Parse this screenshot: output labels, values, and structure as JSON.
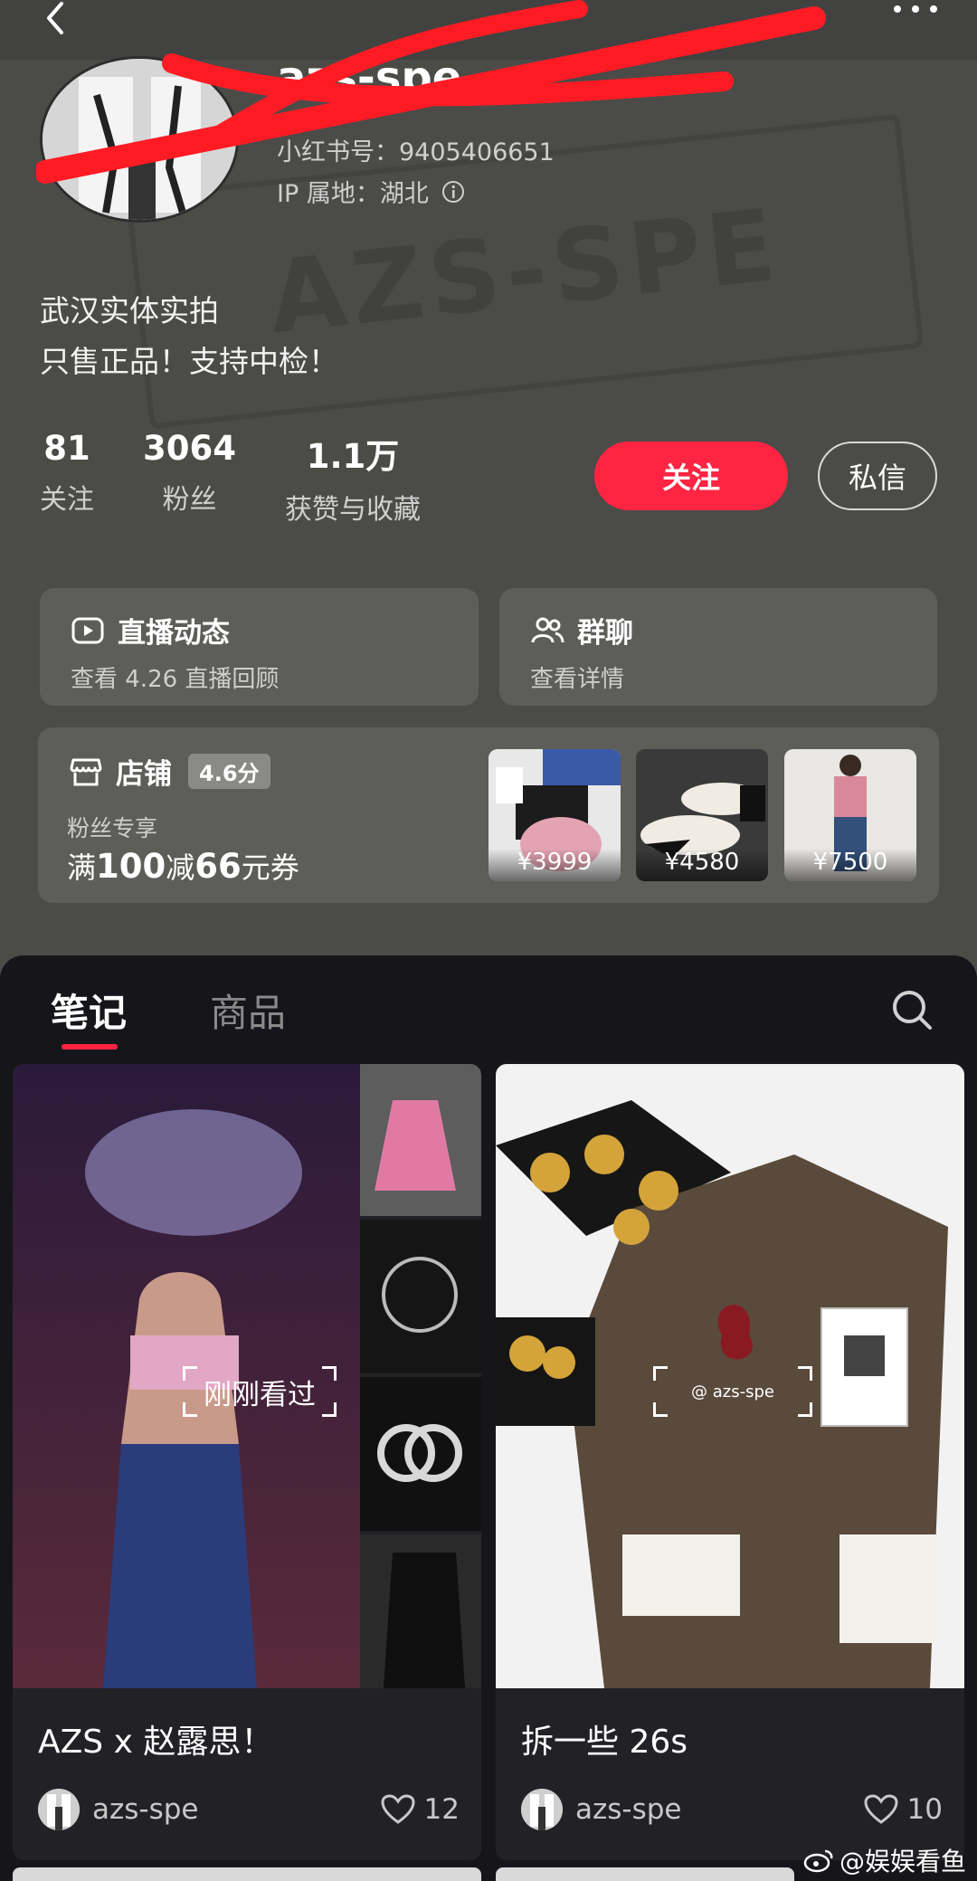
{
  "header": {
    "back_icon": "chevron-left-icon",
    "more_icon": "more-dots-icon"
  },
  "background": {
    "watermark": "AZS-SPE"
  },
  "profile": {
    "username": "azs-spe",
    "redbook_id": "小红书号：9405406651",
    "ip_location": "IP 属地：湖北",
    "bio_line1": "武汉实体实拍",
    "bio_line2": "只售正品！支持中检！"
  },
  "stats": [
    {
      "num": "81",
      "label": "关注"
    },
    {
      "num": "3064",
      "label": "粉丝"
    },
    {
      "num": "1.1万",
      "label": "获赞与收藏"
    }
  ],
  "actions": {
    "follow_label": "关注",
    "message_label": "私信",
    "accent_color": "#ff2442"
  },
  "live_card": {
    "title": "直播动态",
    "subtitle": "查看 4.26 直播回顾"
  },
  "group_card": {
    "title": "群聊",
    "subtitle": "查看详情"
  },
  "shop_card": {
    "title": "店铺",
    "rating": "4.6分",
    "fan_label": "粉丝专享",
    "coupon_prefix": "满",
    "coupon_min": "100",
    "coupon_mid": "减",
    "coupon_off": "66",
    "coupon_suffix": "元券",
    "products": [
      {
        "price": "¥3999"
      },
      {
        "price": "¥4580"
      },
      {
        "price": "¥7500"
      }
    ]
  },
  "tabs": {
    "notes": "笔记",
    "goods": "商品"
  },
  "posts": [
    {
      "title": "AZS x 赵露思！",
      "author": "azs-spe",
      "likes": "12",
      "overlay": "刚刚看过"
    },
    {
      "title": "拆一些 26s",
      "author": "azs-spe",
      "likes": "10",
      "overlay": "@ azs-spe"
    }
  ],
  "footer_watermark": "@娱娱看鱼"
}
